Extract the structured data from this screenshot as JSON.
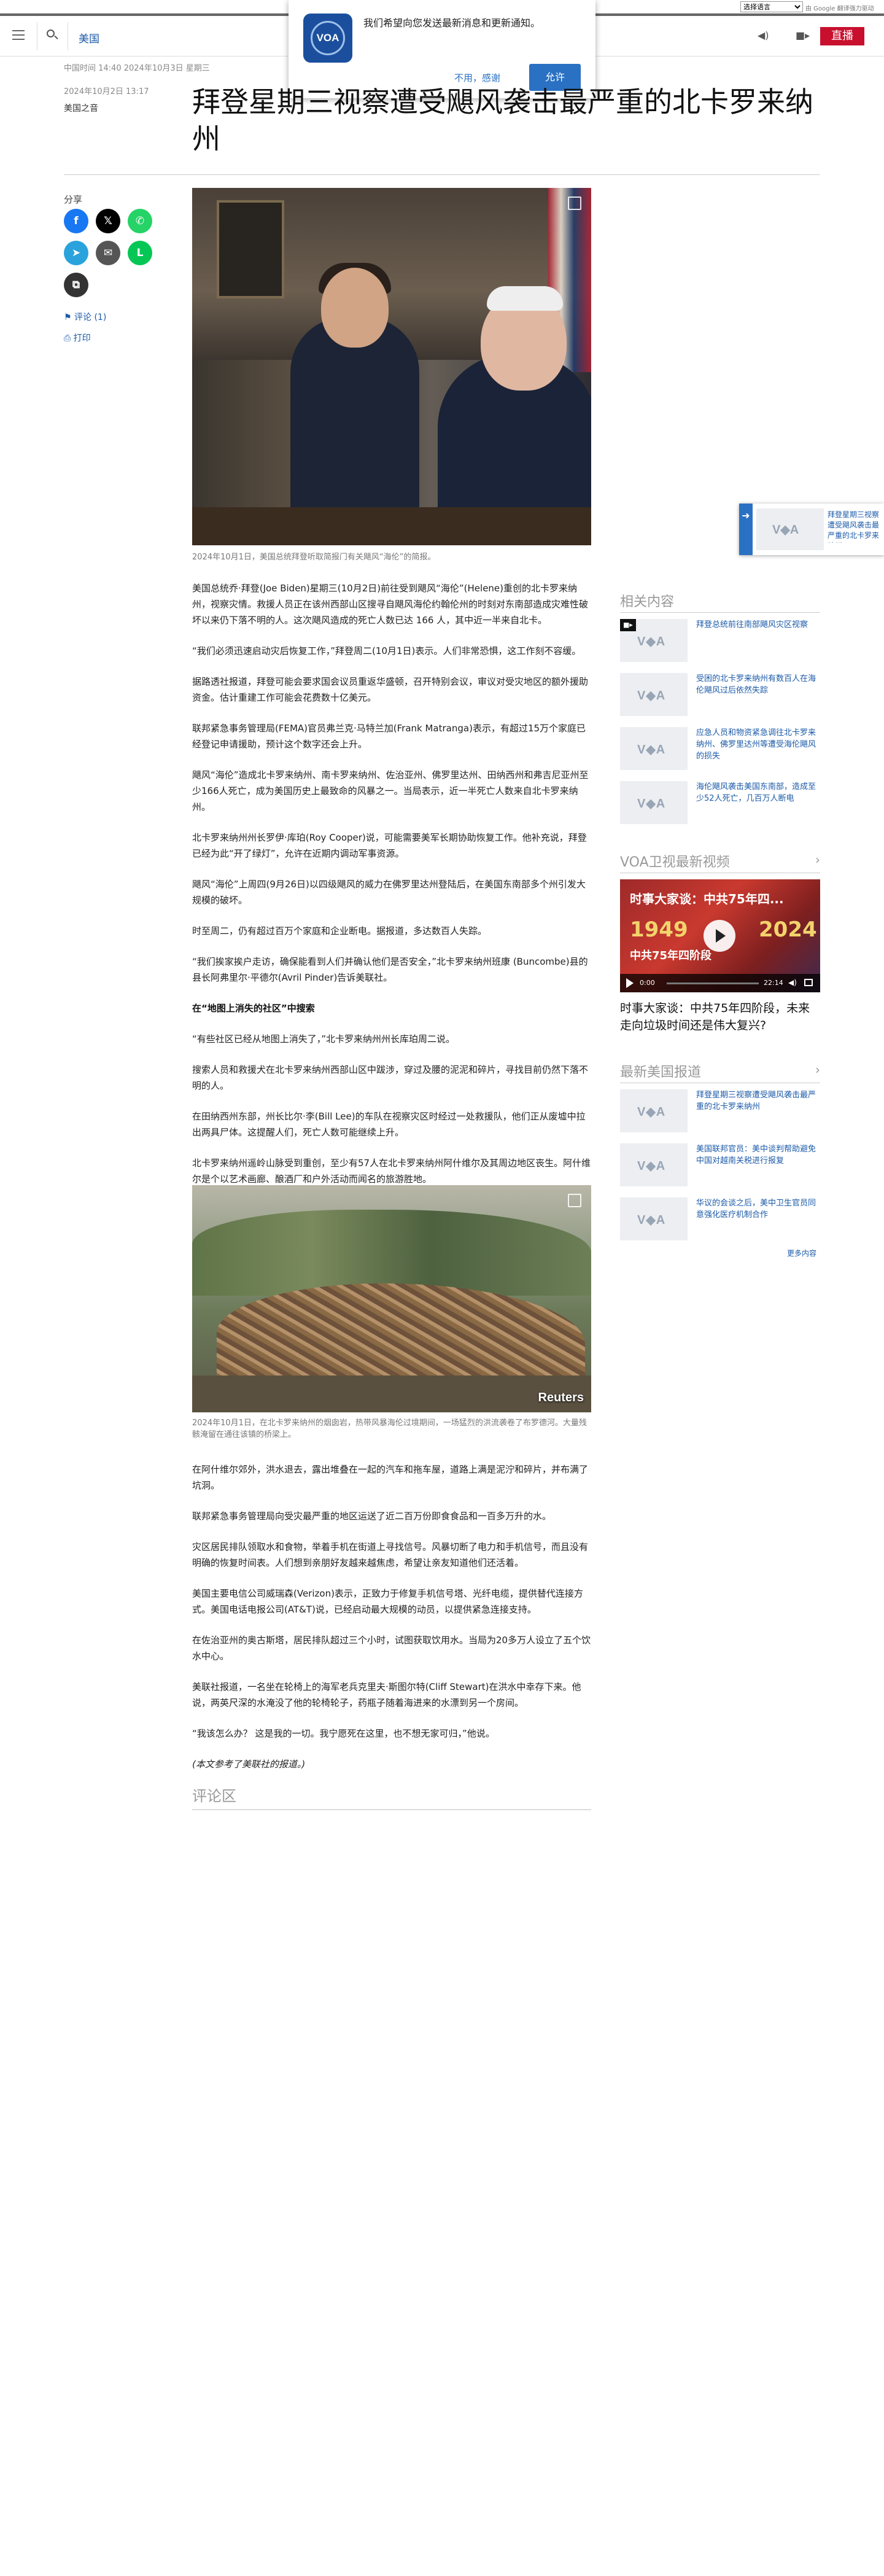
{
  "translate": {
    "select_label": "选择语言",
    "powered_by": "由 Google 翻译强力驱动"
  },
  "header": {
    "section_link": "美国",
    "live_label": "直播"
  },
  "notification": {
    "logo_text": "VOA",
    "message": "我们希望向您发送最新消息和更新通知。",
    "decline": "不用，感谢",
    "accept": "允许"
  },
  "article": {
    "dateline": "中国时间 14:40 2024年10月3日 星期三",
    "pubdate": "2024年10月2日 13:17",
    "category": "美国之音",
    "title": "拜登星期三视察遭受飓风袭击最严重的北卡罗来纳州",
    "hero_caption": "2024年10月1日，美国总统拜登听取简报门有关飓风“海伦”的简报。",
    "paragraphs": [
      "美国总统乔·拜登(Joe Biden)星期三(10月2日)前往受到飓风“海伦”(Helene)重创的北卡罗来纳州，视察灾情。救援人员正在该州西部山区搜寻自飓风海伦约翰伦州的时刻对东南部造成灾难性破坏以来仍下落不明的人。这次飓风造成的死亡人数已达 166 人，其中近一半来自北卡。",
      "“我们必须迅速启动灾后恢复工作，”拜登周二(10月1日)表示。人们非常恐惧，这工作刻不容缓。",
      "据路透社报道，拜登可能会要求国会议员重返华盛顿，召开特别会议，审议对受灾地区的额外援助资金。估计重建工作可能会花费数十亿美元。",
      "联邦紧急事务管理局(FEMA)官员弗兰克·马特兰加(Frank Matranga)表示，有超过15万个家庭已经登记申请援助，预计这个数字还会上升。",
      "飓风“海伦”造成北卡罗来纳州、南卡罗来纳州、佐治亚州、佛罗里达州、田纳西州和弗吉尼亚州至少166人死亡，成为美国历史上最致命的风暴之一。当局表示，近一半死亡人数来自北卡罗来纳州。",
      "北卡罗来纳州州长罗伊·库珀(Roy Cooper)说，可能需要美军长期协助恢复工作。他补充说，拜登已经为此“开了绿灯”，允许在近期内调动军事资源。",
      "飓风“海伦”上周四(9月26日)以四级飓风的威力在佛罗里达州登陆后，在美国东南部多个州引发大规模的破坏。",
      "时至周二，仍有超过百万个家庭和企业断电。据报道，多达数百人失踪。",
      "“我们挨家挨户走访，确保能看到人们并确认他们是否安全，”北卡罗来纳州班康 (Buncombe)县的县长阿弗里尔·平德尔(Avril Pinder)告诉美联社。"
    ],
    "subhead": "在“地图上消失的社区”中搜索",
    "paragraphs_b": [
      "“有些社区已经从地图上消失了，”北卡罗来纳州州长库珀周二说。",
      "搜索人员和救援犬在北卡罗来纳州西部山区中跋涉，穿过及腰的泥泥和碎片，寻找目前仍然下落不明的人。",
      "在田纳西州东部，州长比尔·李(Bill Lee)的车队在视察灾区时经过一处救援队，他们正从废墟中拉出两具尸体。这提醒人们，死亡人数可能继续上升。",
      "北卡罗来纳州遥岭山脉受到重创，至少有57人在北卡罗来纳州阿什维尔及其周边地区丧生。阿什维尔是个以艺术画廊、酿酒厂和户外活动而闻名的旅游胜地。"
    ],
    "flood_caption": "2024年10月1日，在北卡罗来纳州的烟囱岩，热带风暴海伦过境期间，一场猛烈的洪流袭卷了布罗德河。大量残骸淹留在通往该镇的桥梁上。",
    "flood_credit": "Reuters",
    "paragraphs_c": [
      "在阿什维尔郊外，洪水退去，露出堆叠在一起的汽车和拖车屋，道路上满是泥泞和碎片，并布满了坑洞。",
      "联邦紧急事务管理局向受灾最严重的地区运送了近二百万份即食食品和一百多万升的水。",
      "灾区居民排队领取水和食物，举着手机在街道上寻找信号。风暴切断了电力和手机信号，而且没有明确的恢复时间表。人们想到亲朋好友越来越焦虑，希望让亲友知道他们还活着。",
      "美国主要电信公司威瑞森(Verizon)表示，正致力于修复手机信号塔、光纤电缆，提供替代连接方式。美国电话电报公司(AT&T)说，已经启动最大规模的动员，以提供紧急连接支持。",
      "在佐治亚州的奥古斯塔，居民排队超过三个小时，试图获取饮用水。当局为20多万人设立了五个饮水中心。",
      "美联社报道，一名坐在轮椅上的海军老兵克里夫·斯图尔特(Cliff Stewart)在洪水中幸存下来。他说，两英尺深的水淹没了他的轮椅轮子，药瓶子随着海进来的水漂到另一个房间。",
      "“我该怎么办？ 这是我的一切。我宁愿死在这里，也不想无家可归，”他说。"
    ],
    "source_note": "(本文参考了美联社的报道。)"
  },
  "share": {
    "label": "分享",
    "comments": "评论 (1)",
    "print": "打印",
    "icons": [
      {
        "name": "facebook-share-icon",
        "glyph": "f",
        "color": "#1877f2"
      },
      {
        "name": "x-share-icon",
        "glyph": "𝕏",
        "color": "#000000"
      },
      {
        "name": "whatsapp-share-icon",
        "glyph": "✆",
        "color": "#25d366"
      },
      {
        "name": "telegram-share-icon",
        "glyph": "➤",
        "color": "#2aa3dc"
      },
      {
        "name": "email-share-icon",
        "glyph": "✉",
        "color": "#555555"
      },
      {
        "name": "line-share-icon",
        "glyph": "L",
        "color": "#06c755"
      },
      {
        "name": "copy-link-icon",
        "glyph": "⧉",
        "color": "#333333"
      }
    ]
  },
  "comments_section": {
    "header": "评论区"
  },
  "sidebar": {
    "related_header": "相关内容",
    "related": [
      {
        "text": "拜登总统前往南部飓风灾区视察",
        "video": true
      },
      {
        "text": "受困的北卡罗来纳州有数百人在海伦飓风过后依然失踪",
        "video": false
      },
      {
        "text": "应急人员和物资紧急调往北卡罗来纳州、佛罗里达州等遭受海伦飓风的损失",
        "video": false
      },
      {
        "text": "海伦飓风袭击美国东南部，造成至少52人死亡，几百万人断电",
        "video": false
      }
    ],
    "video_header": "VOA卫视最新视频",
    "video": {
      "title": "时事大家谈：中共75年四阶段，未来走向垃圾时间还是伟大复兴?",
      "overlay_title": "时事大家谈：中共75年四...",
      "year_a": "1949",
      "year_b": "2024",
      "overlay_sub": "中共75年四阶段",
      "time_current": "0:00",
      "time_total": "22:14"
    },
    "latest_header": "最新美国报道",
    "latest": [
      {
        "text": "拜登星期三视察遭受飓风袭击最严重的北卡罗来纳州"
      },
      {
        "text": "美国联邦官员：美中谈判帮助避免中国对越南关税进行报复"
      },
      {
        "text": "华议的会谈之后，美中卫生官员同意强化医疗机制合作"
      }
    ],
    "more": "更多内容"
  },
  "promo": {
    "text": "拜登星期三视察遭受飓风袭击最严重的北卡罗来纳州"
  }
}
